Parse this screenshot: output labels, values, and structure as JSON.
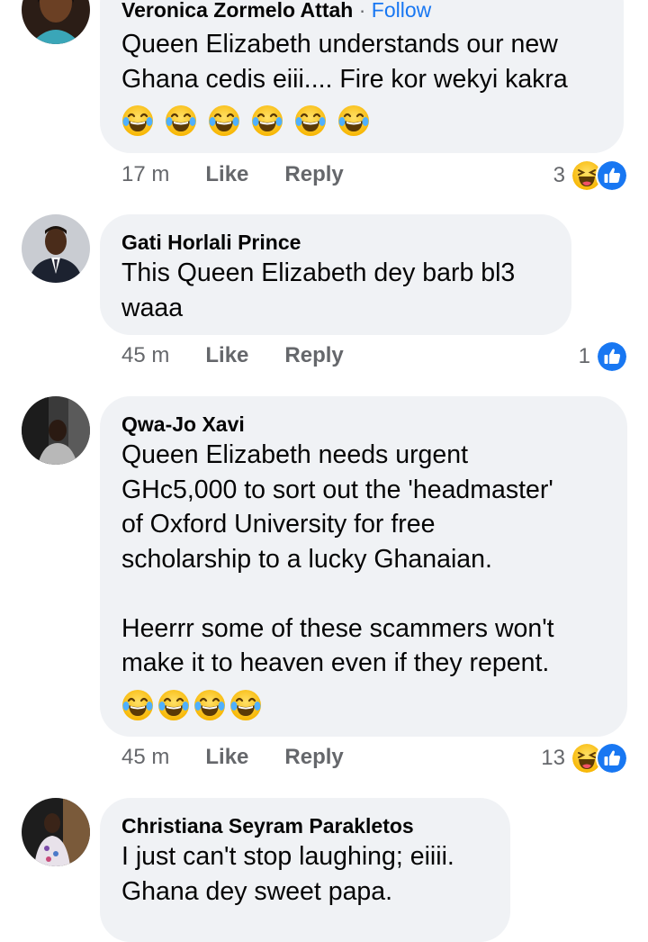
{
  "comments": [
    {
      "author": "Veronica Zormelo Attah",
      "follow_sep": "·",
      "follow": "Follow",
      "text": "Queen Elizabeth understands our new\nGhana cedis eiii.... Fire kor wekyi kakra",
      "emoji_count": 6,
      "time": "17 m",
      "like": "Like",
      "reply": "Reply",
      "reaction_count": "3",
      "reactions": [
        "haha-icon",
        "like-icon"
      ]
    },
    {
      "author": "Gati Horlali Prince",
      "text": "This Queen Elizabeth dey barb bl3\nwaaa",
      "time": "45 m",
      "like": "Like",
      "reply": "Reply",
      "reaction_count": "1",
      "reactions": [
        "like-icon"
      ]
    },
    {
      "author": "Qwa-Jo Xavi",
      "text": "Queen Elizabeth needs urgent\nGHc5,000 to sort out the 'headmaster'\nof Oxford University for free\nscholarship to a lucky Ghanaian.\n\nHeerrr some of these scammers won't\nmake it to heaven even if they repent.",
      "emoji_count": 4,
      "time": "45 m",
      "like": "Like",
      "reply": "Reply",
      "reaction_count": "13",
      "reactions": [
        "haha-icon",
        "like-icon"
      ]
    },
    {
      "author": "Christiana Seyram Parakletos",
      "text": "I just can't stop laughing; eiiii.\nGhana dey sweet papa."
    }
  ],
  "colors": {
    "bubble": "#f0f2f5",
    "link": "#1877f2",
    "meta": "#65676b",
    "text": "#050505"
  }
}
